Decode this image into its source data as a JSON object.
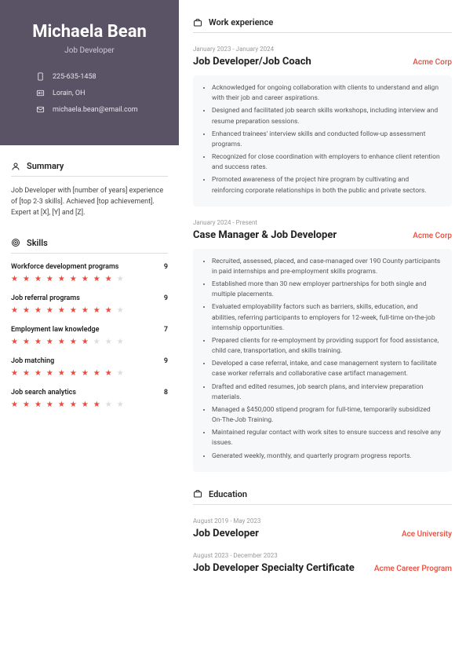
{
  "hero": {
    "name": "Michaela Bean",
    "title": "Job Developer",
    "phone": "225-635-1458",
    "location": "Lorain, OH",
    "email": "michaela.bean@email.com"
  },
  "sections": {
    "summary_label": "Summary",
    "skills_label": "Skills",
    "work_label": "Work experience",
    "education_label": "Education"
  },
  "summary": "Job Developer with [number of years] experience of [top 2-3 skills]. Achieved [top achievement]. Expert at [X], [Y] and [Z].",
  "skills": [
    {
      "name": "Workforce development programs",
      "score": 9
    },
    {
      "name": "Job referral programs",
      "score": 9
    },
    {
      "name": "Employment law knowledge",
      "score": 7
    },
    {
      "name": "Job matching",
      "score": 9
    },
    {
      "name": "Job search analytics",
      "score": 8
    }
  ],
  "experience": [
    {
      "dates": "January 2023 - January 2024",
      "title": "Job Developer/Job Coach",
      "company": "Acme Corp",
      "bullets": [
        "Acknowledged for ongoing collaboration with clients to understand and align with their job and career aspirations.",
        "Designed and facilitated job search skills workshops, including interview and resume preparation sessions.",
        "Enhanced trainees' interview skills and conducted follow-up assessment programs.",
        "Recognized for close coordination with employers to enhance client retention and success rates.",
        "Promoted awareness of the project hire program by cultivating and reinforcing corporate relationships in both the public and private sectors."
      ]
    },
    {
      "dates": "January 2024 - Present",
      "title": "Case Manager & Job Developer",
      "company": "Acme Corp",
      "bullets": [
        "Recruited, assessed, placed, and case-managed over 190 County participants in paid internships and pre-employment skills programs.",
        "Established more than 30 new employer partnerships for both single and multiple placements.",
        "Evaluated employability factors such as barriers, skills, education, and abilities, referring participants to employers for 12-week, full-time on-the-job internship opportunities.",
        "Prepared clients for re-employment by providing support for food assistance, child care, transportation, and skills training.",
        "Developed a case referral, intake, and case management system to facilitate case worker referrals and collaborative case artifact management.",
        "Drafted and edited resumes, job search plans, and interview preparation materials.",
        "Managed a $450,000 stipend program for full-time, temporarily subsidized On-The-Job Training.",
        "Maintained regular contact with work sites to ensure success and resolve any issues.",
        "Generated weekly, monthly, and quarterly program progress reports."
      ]
    }
  ],
  "education": [
    {
      "dates": "August 2019 - May 2023",
      "title": "Job Developer",
      "school": "Ace University"
    },
    {
      "dates": "August 2023 - December 2023",
      "title": "Job Developer Specialty Certificate",
      "school": "Acme Career Program"
    }
  ]
}
